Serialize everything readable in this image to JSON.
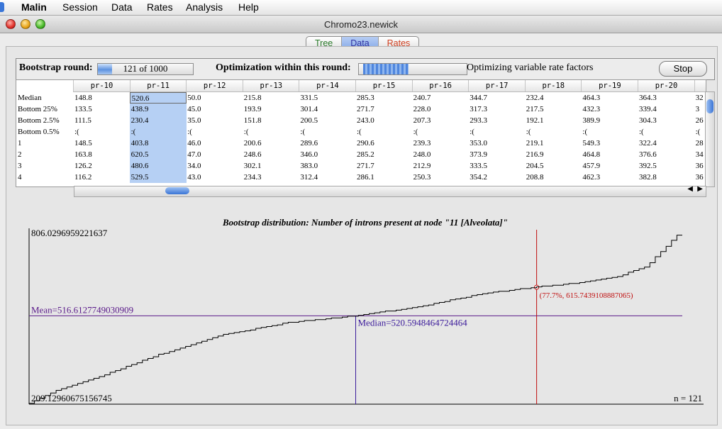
{
  "menubar": {
    "app": "Malin",
    "items": [
      "Session",
      "Data",
      "Rates",
      "Analysis",
      "Help"
    ]
  },
  "window": {
    "title": "Chromo23.newick"
  },
  "tabs": [
    {
      "label": "Tree",
      "color": "#2a7a2a"
    },
    {
      "label": "Data",
      "color": "#3030a0"
    },
    {
      "label": "Rates",
      "color": "#d04020"
    }
  ],
  "bootstrap": {
    "label": "Bootstrap round:",
    "progress_text": "121 of 1000",
    "progress_fraction": 0.121,
    "optimization_label": "Optimization within this round:",
    "status": "Optimizing variable rate factors",
    "stop_label": "Stop"
  },
  "table": {
    "row_labels": [
      "Median",
      "Bottom 25%",
      "Bottom 2.5%",
      "Bottom 0.5%",
      "1",
      "2",
      "3",
      "4"
    ],
    "columns": [
      {
        "header": "pr-10",
        "values": [
          "148.8",
          "133.5",
          "111.5",
          ":(",
          "148.5",
          "163.8",
          "126.2",
          "116.2"
        ]
      },
      {
        "header": "pr-11",
        "values": [
          "520.6",
          "438.9",
          "230.4",
          ":(",
          "403.8",
          "620.5",
          "480.6",
          "529.5"
        ]
      },
      {
        "header": "pr-12",
        "values": [
          "50.0",
          "45.0",
          "35.0",
          ":(",
          "46.0",
          "47.0",
          "34.0",
          "43.0"
        ]
      },
      {
        "header": "pr-13",
        "values": [
          "215.8",
          "193.9",
          "151.8",
          ":(",
          "200.6",
          "248.6",
          "302.1",
          "234.3"
        ]
      },
      {
        "header": "pr-14",
        "values": [
          "331.5",
          "301.4",
          "200.5",
          ":(",
          "289.6",
          "346.0",
          "383.0",
          "312.4"
        ]
      },
      {
        "header": "pr-15",
        "values": [
          "285.3",
          "271.7",
          "243.0",
          ":(",
          "290.6",
          "285.2",
          "271.7",
          "286.1"
        ]
      },
      {
        "header": "pr-16",
        "values": [
          "240.7",
          "228.0",
          "207.3",
          ":(",
          "239.3",
          "248.0",
          "212.9",
          "250.3"
        ]
      },
      {
        "header": "pr-17",
        "values": [
          "344.7",
          "317.3",
          "293.3",
          ":(",
          "353.0",
          "373.9",
          "333.5",
          "354.2"
        ]
      },
      {
        "header": "pr-18",
        "values": [
          "232.4",
          "217.5",
          "192.1",
          ":(",
          "219.1",
          "216.9",
          "204.5",
          "208.8"
        ]
      },
      {
        "header": "pr-19",
        "values": [
          "464.3",
          "432.3",
          "389.9",
          ":(",
          "549.3",
          "464.8",
          "457.9",
          "462.3"
        ]
      },
      {
        "header": "pr-20",
        "values": [
          "364.3",
          "339.4",
          "304.3",
          ":(",
          "322.4",
          "376.6",
          "392.5",
          "382.8"
        ]
      }
    ],
    "partial_column": [
      "32",
      "3",
      "26",
      ":(",
      "28",
      "34",
      "36",
      "36"
    ],
    "selection_color": "#b6d0f4"
  },
  "chart_data": {
    "type": "line",
    "title": "Bootstrap distribution: Number of introns present at node \"11 [Alveolata]\"",
    "ymax_label": "806.0296959221637",
    "ymin_label": "209.12960675156745",
    "ylim": [
      209.12960675156745,
      806.0296959221637
    ],
    "n_label": "n = 121",
    "mean_label": "Mean=516.6127749030909",
    "mean": 516.6127749030909,
    "median_label": "Median=520.5948464724464",
    "median": 520.5948464724464,
    "cursor_label": "(77.7%, 615.7439108887065)",
    "cursor": {
      "percentile": 0.777,
      "value": 615.7439108887065
    },
    "curve_points": [
      [
        0.0,
        209.1
      ],
      [
        0.05,
        262.0
      ],
      [
        0.1,
        295.0
      ],
      [
        0.2,
        380.0
      ],
      [
        0.3,
        450.0
      ],
      [
        0.4,
        493.0
      ],
      [
        0.5,
        516.0
      ],
      [
        0.6,
        548.0
      ],
      [
        0.7,
        595.0
      ],
      [
        0.777,
        615.74
      ],
      [
        0.85,
        633.0
      ],
      [
        0.9,
        650.0
      ],
      [
        0.95,
        690.0
      ],
      [
        0.97,
        738.0
      ],
      [
        1.0,
        806.03
      ]
    ],
    "mean_color": "#5a1a8a",
    "cursor_color": "#c01010"
  }
}
